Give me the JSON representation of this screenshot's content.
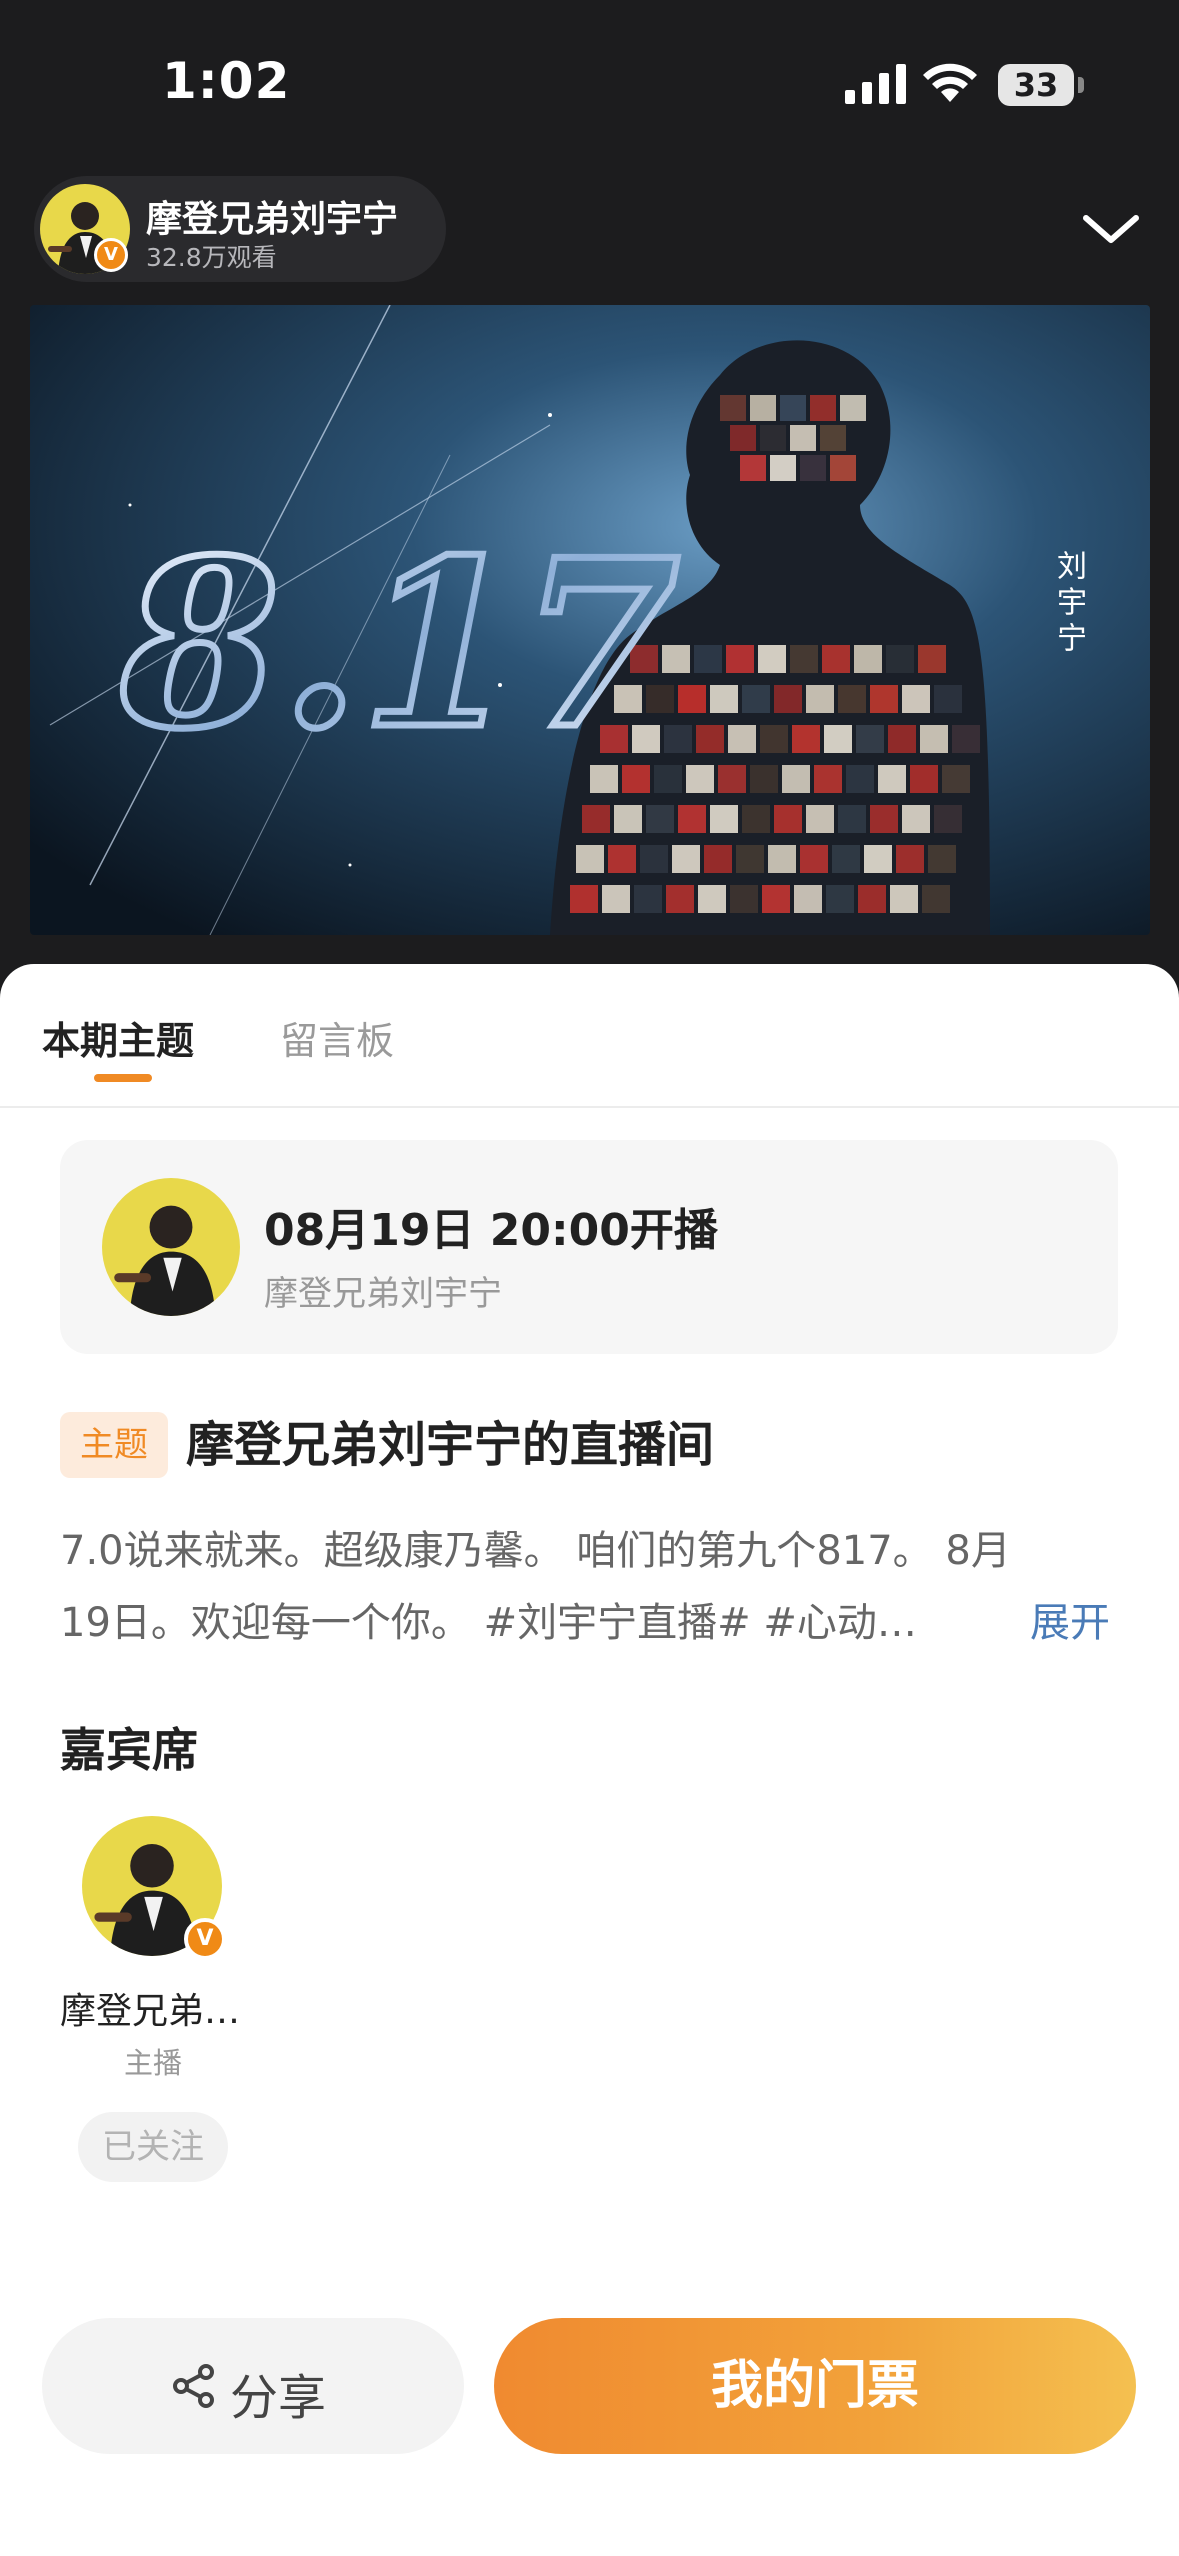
{
  "status_bar": {
    "time": "1:02",
    "battery": "33",
    "icons": [
      "cellular-signal-icon",
      "wifi-icon",
      "battery-icon"
    ]
  },
  "host": {
    "name": "摩登兄弟刘宇宁",
    "views": "32.8万观看",
    "verified_icon": "verified-v-icon",
    "collapse_icon": "chevron-down-icon"
  },
  "cover": {
    "headline": "8.17",
    "vertical_text": "刘宇宁"
  },
  "tabs": [
    {
      "label": "本期主题",
      "active": true
    },
    {
      "label": "留言板",
      "active": false
    }
  ],
  "schedule": {
    "time": "08月19日 20:00开播",
    "host": "摩登兄弟刘宇宁"
  },
  "topic": {
    "tag": "主题",
    "title": "摩登兄弟刘宇宁的直播间",
    "desc_line1": "7.0说来就来。超级康乃馨。 咱们的第九个817。 8月",
    "desc_line2": "19日。欢迎每一个你。 #刘宇宁直播# #心动…",
    "expand": "展开"
  },
  "guests": {
    "heading": "嘉宾席",
    "items": [
      {
        "name": "摩登兄弟…",
        "role": "主播",
        "follow": "已关注"
      }
    ]
  },
  "actions": {
    "share": "分享",
    "ticket": "我的门票"
  },
  "colors": {
    "accent": "#f08a24",
    "link": "#4a7bb7",
    "dark_bg": "#1c1c1e"
  }
}
